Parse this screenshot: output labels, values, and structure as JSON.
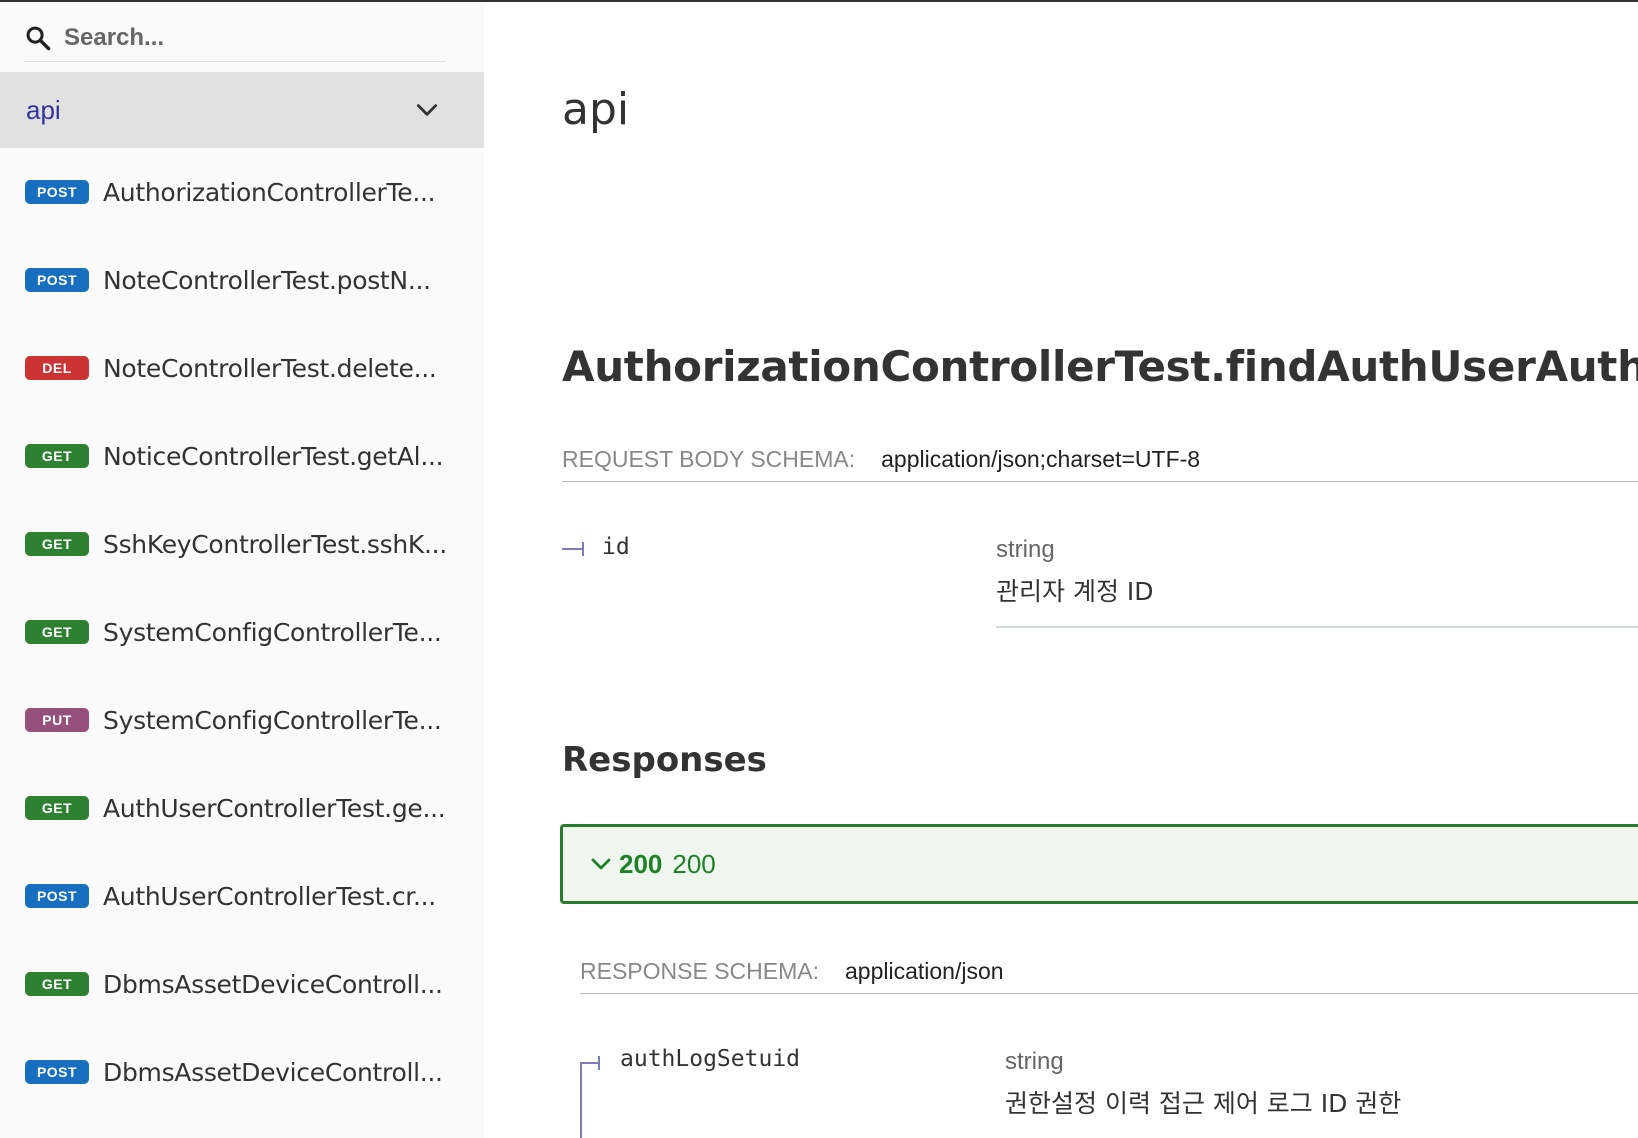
{
  "search": {
    "placeholder": "Search..."
  },
  "sidebar": {
    "group": {
      "title": "api"
    },
    "endpoints": [
      {
        "method": "POST",
        "label": "AuthorizationControllerTe..."
      },
      {
        "method": "POST",
        "label": "NoteControllerTest.postN..."
      },
      {
        "method": "DEL",
        "label": "NoteControllerTest.delete..."
      },
      {
        "method": "GET",
        "label": "NoticeControllerTest.getAl..."
      },
      {
        "method": "GET",
        "label": "SshKeyControllerTest.sshK..."
      },
      {
        "method": "GET",
        "label": "SystemConfigControllerTe..."
      },
      {
        "method": "PUT",
        "label": "SystemConfigControllerTe..."
      },
      {
        "method": "GET",
        "label": "AuthUserControllerTest.ge..."
      },
      {
        "method": "POST",
        "label": "AuthUserControllerTest.cr..."
      },
      {
        "method": "GET",
        "label": "DbmsAssetDeviceControll..."
      },
      {
        "method": "POST",
        "label": "DbmsAssetDeviceControll..."
      }
    ]
  },
  "main": {
    "tag_title": "api",
    "operation_title": "AuthorizationControllerTest.findAuthUserAuthBy",
    "request_schema": {
      "label": "REQUEST BODY SCHEMA:",
      "value": "application/json;charset=UTF-8"
    },
    "request_param": {
      "name": "id",
      "type": "string",
      "description": "관리자 계정 ID"
    },
    "responses_title": "Responses",
    "response": {
      "code": "200",
      "description": "200"
    },
    "response_schema": {
      "label": "RESPONSE SCHEMA:",
      "value": "application/json"
    },
    "response_field": {
      "name": "authLogSetuid",
      "type": "string",
      "description": "권한설정 이력 접근 제어 로그 ID 권한"
    }
  },
  "colors": {
    "post": "#186fbf",
    "delete": "#cc3333",
    "get": "#2f8132",
    "put": "#95507c",
    "accent": "#32329f",
    "success": "#1d8127"
  }
}
